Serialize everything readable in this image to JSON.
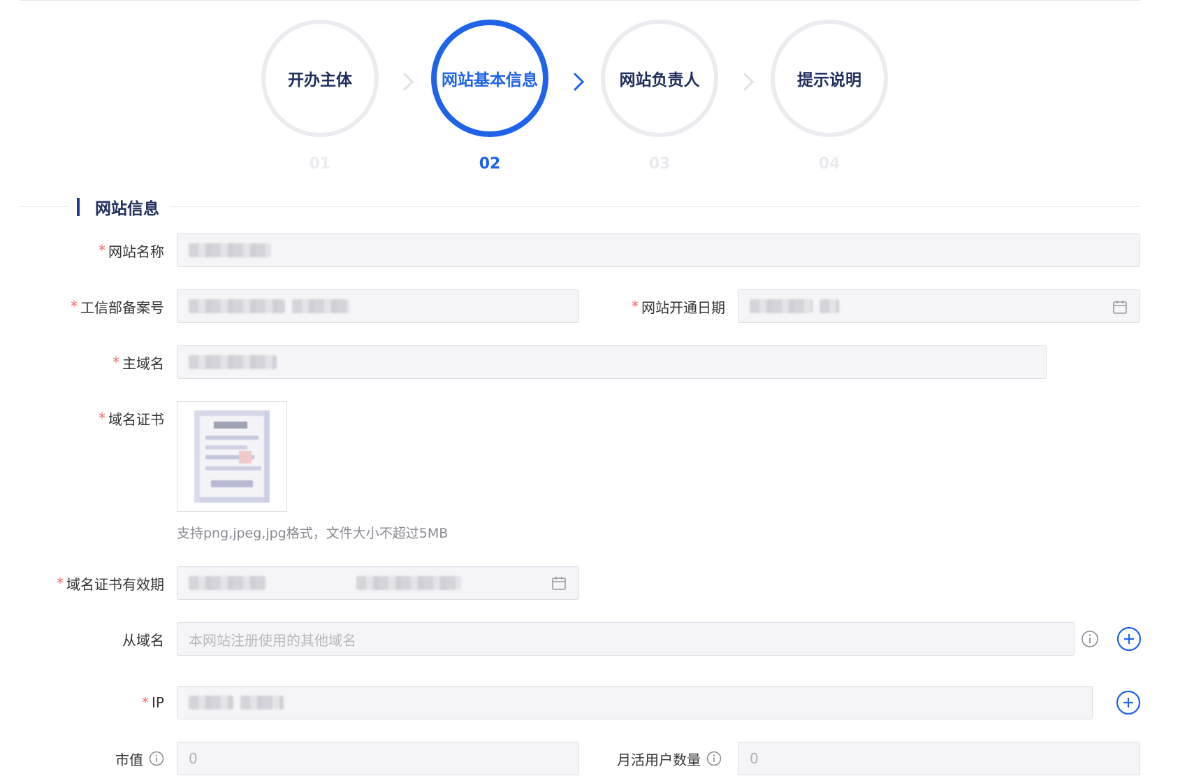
{
  "stepper": {
    "steps": [
      {
        "label": "开办主体",
        "num": "01"
      },
      {
        "label": "网站基本信息",
        "num": "02"
      },
      {
        "label": "网站负责人",
        "num": "03"
      },
      {
        "label": "提示说明",
        "num": "04"
      }
    ],
    "active_index": 1,
    "colors": {
      "active": "#1e63e9",
      "inactive_ring": "#ebebf0",
      "text": "#1f2d5c"
    }
  },
  "section": {
    "title": "网站信息"
  },
  "form": {
    "site_name": {
      "label": "网站名称",
      "required": true,
      "value_redacted": true
    },
    "icp_number": {
      "label": "工信部备案号",
      "required": true,
      "value_redacted": true
    },
    "open_date": {
      "label": "网站开通日期",
      "required": true,
      "value_redacted": true,
      "icon": "calendar-icon"
    },
    "main_domain": {
      "label": "主域名",
      "required": true,
      "value_redacted": true
    },
    "domain_cert": {
      "label": "域名证书",
      "required": true,
      "hint": "支持png,jpeg,jpg格式，文件大小不超过5MB"
    },
    "cert_validity": {
      "label": "域名证书有效期",
      "required": true,
      "value_redacted": true,
      "icon": "calendar-icon"
    },
    "sub_domain": {
      "label": "从域名",
      "required": false,
      "placeholder": "本网站注册使用的其他域名",
      "icons": [
        "info-icon",
        "plus-circle-icon"
      ]
    },
    "ip": {
      "label": "IP",
      "required": true,
      "value_redacted": true,
      "icons": [
        "plus-circle-icon"
      ]
    },
    "market_value": {
      "label": "市值",
      "required": false,
      "value": "0",
      "icons": [
        "info-icon"
      ]
    },
    "mau": {
      "label": "月活用户数量",
      "required": false,
      "value": "0",
      "icons": [
        "info-icon"
      ]
    }
  },
  "required_mark": "*"
}
